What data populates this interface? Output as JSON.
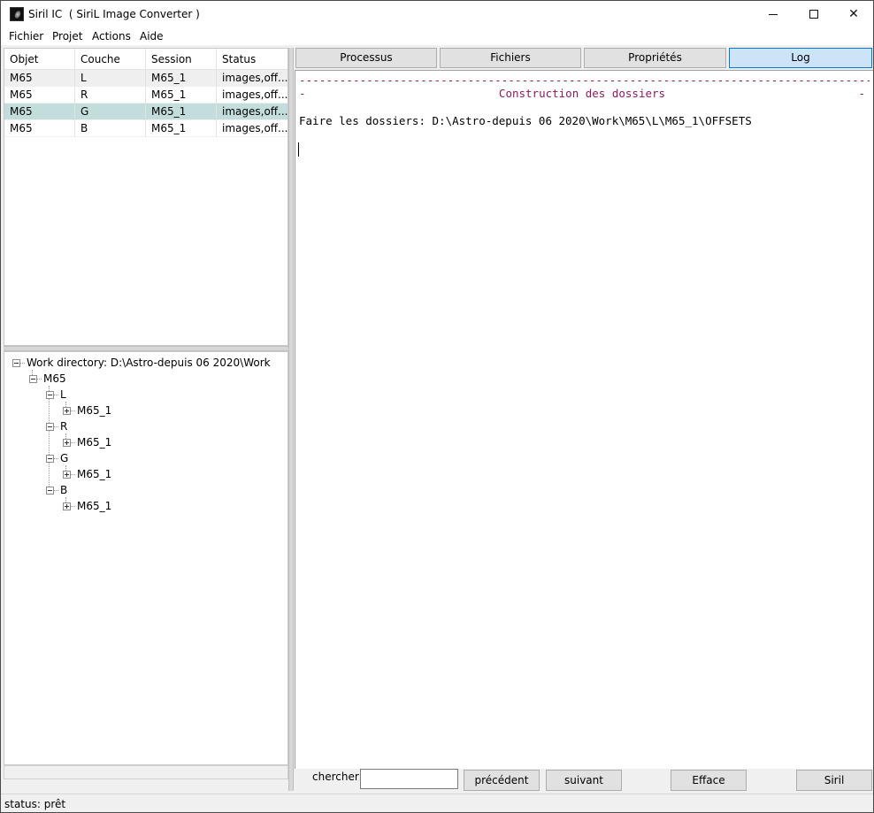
{
  "window": {
    "title": "Siril IC  ( SiriL Image Converter )"
  },
  "menu": {
    "items": [
      "Fichier",
      "Projet",
      "Actions",
      "Aide"
    ]
  },
  "table": {
    "columns": [
      "Objet",
      "Couche",
      "Session",
      "Status"
    ],
    "rows": [
      [
        "M65",
        "L",
        "M65_1",
        "images,off..."
      ],
      [
        "M65",
        "R",
        "M65_1",
        "images,off..."
      ],
      [
        "M65",
        "G",
        "M65_1",
        "images,off..."
      ],
      [
        "M65",
        "B",
        "M65_1",
        "images,off..."
      ]
    ],
    "selected_row": 2
  },
  "tree": {
    "root": "Work directory: D:\\Astro-depuis 06 2020\\Work",
    "object": "M65",
    "layers": [
      {
        "name": "L",
        "session": "M65_1"
      },
      {
        "name": "R",
        "session": "M65_1"
      },
      {
        "name": "G",
        "session": "M65_1"
      },
      {
        "name": "B",
        "session": "M65_1"
      }
    ]
  },
  "tabs": [
    "Processus",
    "Fichiers",
    "Propriétés",
    "Log"
  ],
  "active_tab": "Log",
  "log": {
    "dashes": "--------------------------------------------------------------------------------------",
    "title_dash": "-",
    "title": "Construction des dossiers",
    "line": "Faire les dossiers: D:\\Astro-depuis 06 2020\\Work\\M65\\L\\M65_1\\OFFSETS"
  },
  "toolbar": {
    "search_label": "chercher:",
    "search_value": "",
    "prev_label": "précédent",
    "next_label": "suivant",
    "clear_label": "Efface",
    "siril_label": "Siril"
  },
  "status": {
    "text": "status: prêt"
  },
  "colors": {
    "log_accent": "#8a1b5e",
    "selected_row": "#c3dddc",
    "active_tab": "#cce4f7"
  }
}
